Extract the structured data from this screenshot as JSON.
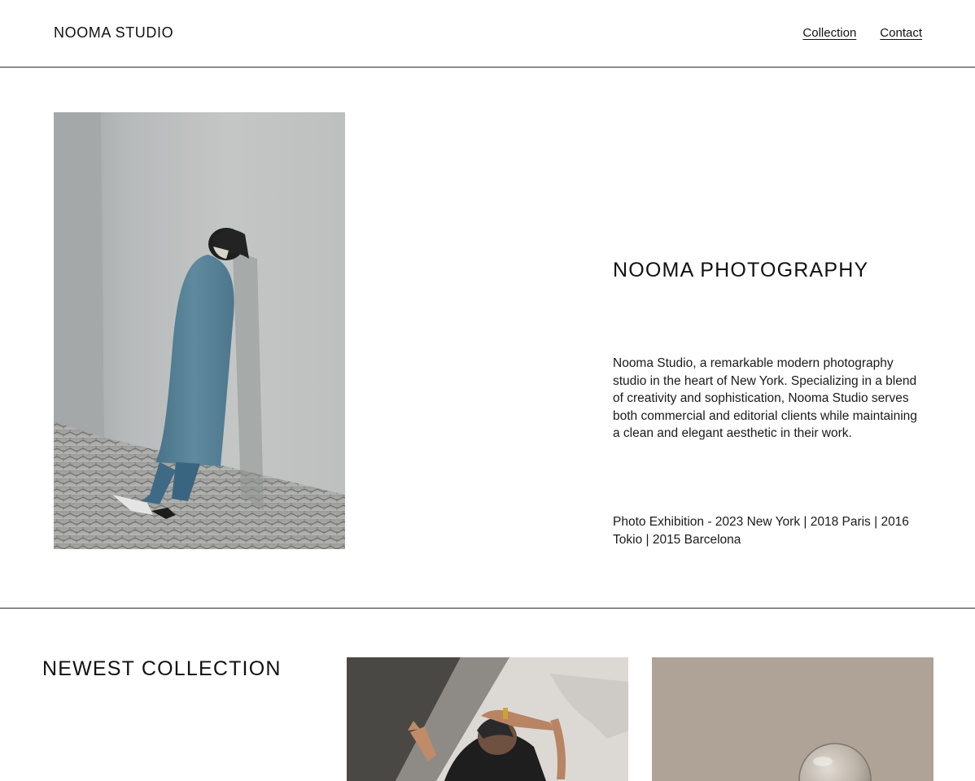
{
  "header": {
    "brand": "NOOMA STUDIO",
    "nav": [
      {
        "label": "Collection"
      },
      {
        "label": "Contact"
      }
    ]
  },
  "hero": {
    "photo_icon": "photo-woman-blue-coat-leaning-on-wall"
  },
  "about": {
    "title": "NOOMA PHOTOGRAPHY",
    "description": "Nooma Studio, a remarkable modern photography studio in the heart of New York. Specializing in a blend of creativity and sophistication, Nooma Studio serves both commercial and editorial clients while maintaining a clean and elegant aesthetic in their work.",
    "exhibitions": "Photo Exhibition - 2023 New York | 2018 Paris | 2016 Tokio | 2015 Barcelona"
  },
  "collection": {
    "title": "NEWEST COLLECTION",
    "items": [
      {
        "icon": "photo-woman-arms-raised-shadow"
      },
      {
        "icon": "photo-glass-bulb-beige-wall"
      }
    ]
  },
  "colors": {
    "text": "#111111",
    "divider": "#2a2a2a",
    "background": "#ffffff"
  }
}
